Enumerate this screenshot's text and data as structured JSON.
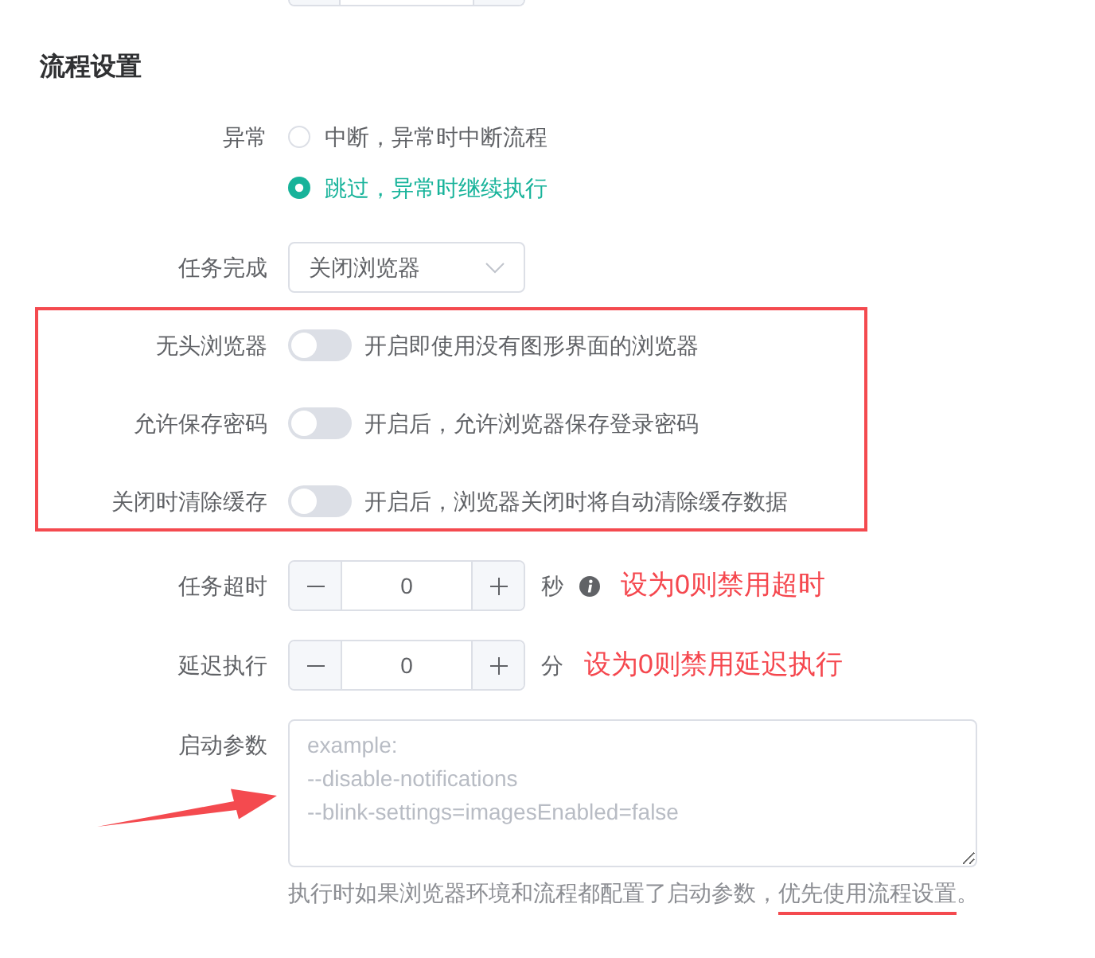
{
  "section": {
    "title": "流程设置"
  },
  "fields": [
    {
      "kind": "radio",
      "label": "异常",
      "options": [
        {
          "text": "中断，异常时中断流程",
          "selected": false
        },
        {
          "text": "跳过，异常时继续执行",
          "selected": true
        }
      ]
    },
    {
      "kind": "select",
      "label": "任务完成",
      "value": "关闭浏览器"
    },
    {
      "kind": "group",
      "framed": true,
      "fields": [
        {
          "kind": "switch",
          "label": "无头浏览器",
          "on": false,
          "description": "开启即使用没有图形界面的浏览器"
        },
        {
          "kind": "switch",
          "label": "允许保存密码",
          "on": false,
          "description": "开启后，允许浏览器保存登录密码"
        },
        {
          "kind": "switch",
          "label": "关闭时清除缓存",
          "on": false,
          "description": "开启后，浏览器关闭时将自动清除缓存数据"
        }
      ]
    },
    {
      "kind": "number",
      "label": "任务超时",
      "value": "0",
      "unit": "秒",
      "info": true,
      "note": "设为0则禁用超时"
    },
    {
      "kind": "number",
      "label": "延迟执行",
      "value": "0",
      "unit": "分",
      "note": "设为0则禁用延迟执行"
    },
    {
      "kind": "textarea",
      "label": "启动参数",
      "placeholder": "example:\n--disable-notifications\n--blink-settings=imagesEnabled=false",
      "pointed": true,
      "hint": [
        {
          "text": "执行时如果浏览器环境和流程都配置了启动参数，",
          "underlined": false
        },
        {
          "text": "优先使用流程设置",
          "underlined": true
        },
        {
          "text": "。",
          "underlined": false
        }
      ]
    }
  ]
}
